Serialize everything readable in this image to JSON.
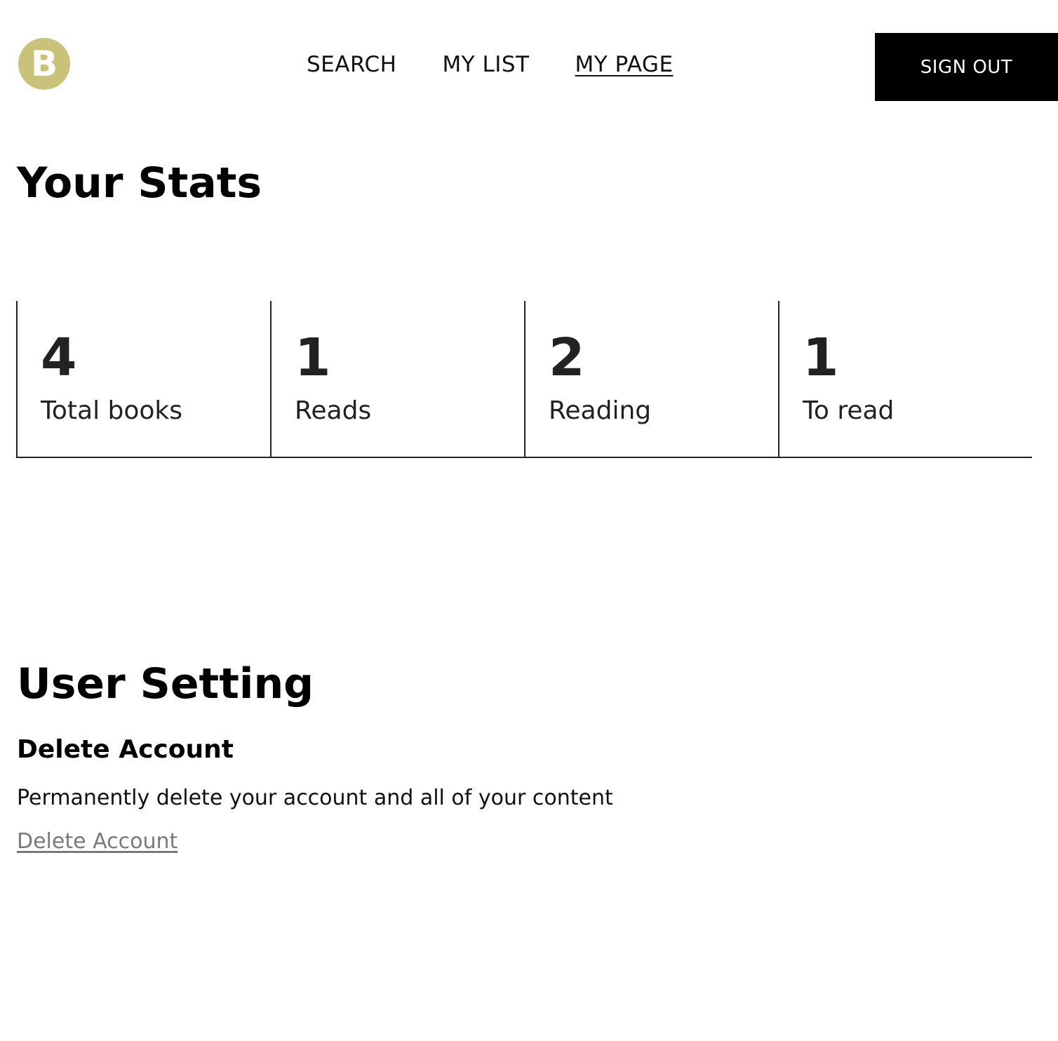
{
  "header": {
    "logo_letter": "B",
    "logo_color": "#cbc27a",
    "nav": [
      {
        "label": "SEARCH",
        "active": false
      },
      {
        "label": "MY LIST",
        "active": false
      },
      {
        "label": "MY PAGE",
        "active": true
      }
    ],
    "sign_out_label": "SIGN OUT"
  },
  "stats": {
    "title": "Your Stats",
    "cards": [
      {
        "value": "4",
        "label": "Total books"
      },
      {
        "value": "1",
        "label": "Reads"
      },
      {
        "value": "2",
        "label": "Reading"
      },
      {
        "value": "1",
        "label": "To read"
      }
    ]
  },
  "settings": {
    "title": "User Setting",
    "delete_heading": "Delete Account",
    "delete_description": "Permanently delete your account and all of your content",
    "delete_link_label": "Delete Account",
    "delete_link_color": "#7a7a7a"
  }
}
